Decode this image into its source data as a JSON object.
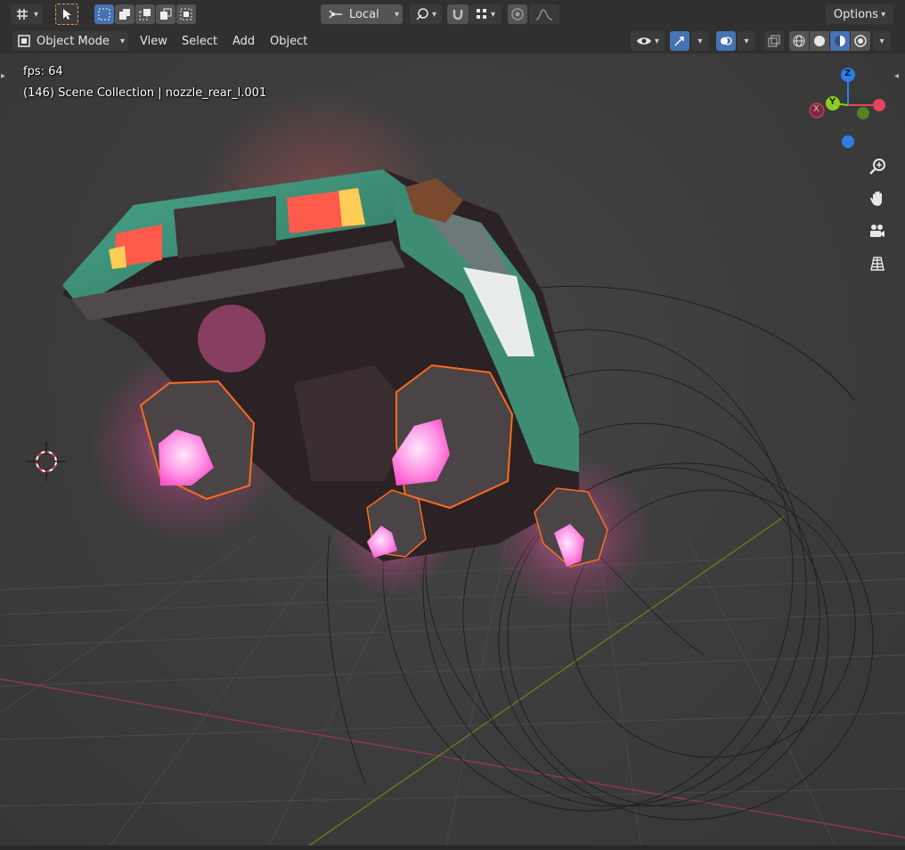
{
  "toolbar": {
    "transform_orientation": "Local",
    "options_label": "Options"
  },
  "header": {
    "mode_label": "Object Mode",
    "menus": [
      "View",
      "Select",
      "Add",
      "Object"
    ]
  },
  "viewport": {
    "fps_text": "fps: 64",
    "collection_text": "(146) Scene Collection | nozzle_rear_l.001"
  },
  "gizmo": {
    "x_label": "X",
    "y_label": "Y",
    "z_label": "Z",
    "x_color": "#e5445e",
    "y_color": "#8ecd1f",
    "z_color": "#2c7fe8"
  },
  "icons": {
    "zoom": "zoom-icon",
    "pan": "hand-icon",
    "camera": "camera-icon",
    "ortho": "grid-icon"
  },
  "colors": {
    "accent": "#4772b3",
    "selection_outline": "#ff6a1f",
    "engine_glow": "#ff8ae6",
    "car_body": "#3f8c75"
  }
}
